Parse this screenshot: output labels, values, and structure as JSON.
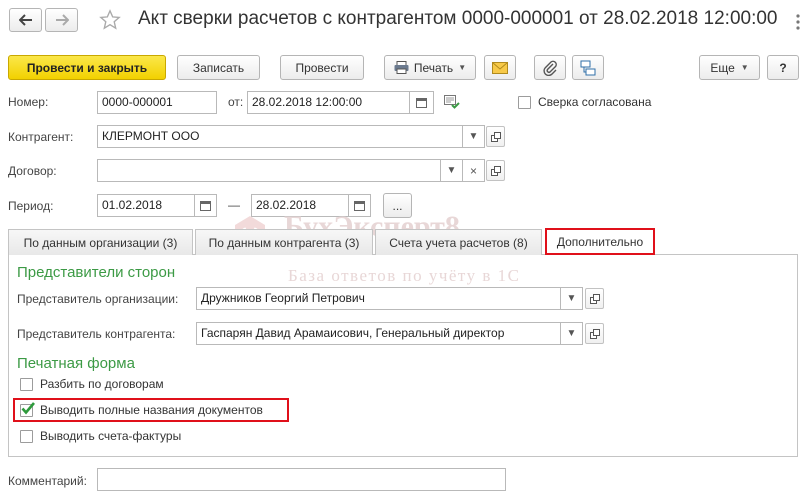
{
  "window": {
    "title": "Акт сверки расчетов с контрагентом 0000-000001 от 28.02.2018 12:00:00"
  },
  "nav": {
    "back": "back-arrow",
    "forward": "forward-arrow",
    "favorite": "star"
  },
  "toolbar": {
    "post_close": "Провести и закрыть",
    "save": "Записать",
    "post": "Провести",
    "print": "Печать",
    "more": "Еще",
    "help": "?"
  },
  "form": {
    "number_label": "Номер:",
    "number": "0000-000001",
    "date_label": "от:",
    "date": "28.02.2018 12:00:00",
    "agreed_label": "Сверка согласована",
    "counterparty_label": "Контрагент:",
    "counterparty": "КЛЕРМОНТ ООО",
    "contract_label": "Договор:",
    "contract": "",
    "period_label": "Период:",
    "period_from": "01.02.2018",
    "period_dash": "—",
    "period_to": "28.02.2018",
    "period_more": "..."
  },
  "tabs": [
    {
      "label": "По данным организации (3)"
    },
    {
      "label": "По данным контрагента (3)"
    },
    {
      "label": "Счета учета расчетов (8)"
    },
    {
      "label": "Дополнительно"
    }
  ],
  "representatives": {
    "heading": "Представители сторон",
    "org_label": "Представитель организации:",
    "org_value": "Дружников Георгий Петрович",
    "cp_label": "Представитель контрагента:",
    "cp_value": "Гаспарян Давид Арамаисович, Генеральный директор"
  },
  "print_form": {
    "heading": "Печатная форма",
    "options": [
      {
        "label": "Разбить по договорам",
        "checked": false
      },
      {
        "label": "Выводить полные названия документов",
        "checked": true
      },
      {
        "label": "Выводить счета-фактуры",
        "checked": false
      }
    ]
  },
  "comment": {
    "label": "Комментарий:",
    "value": ""
  },
  "watermark": {
    "brand": "БухЭксперт8",
    "tagline": "База ответов по учёту в 1С"
  },
  "colors": {
    "accent_yellow": "#f2d100",
    "highlight_red": "#e0101a",
    "section_green": "#3c9a45",
    "check_green": "#2e9a3c"
  }
}
